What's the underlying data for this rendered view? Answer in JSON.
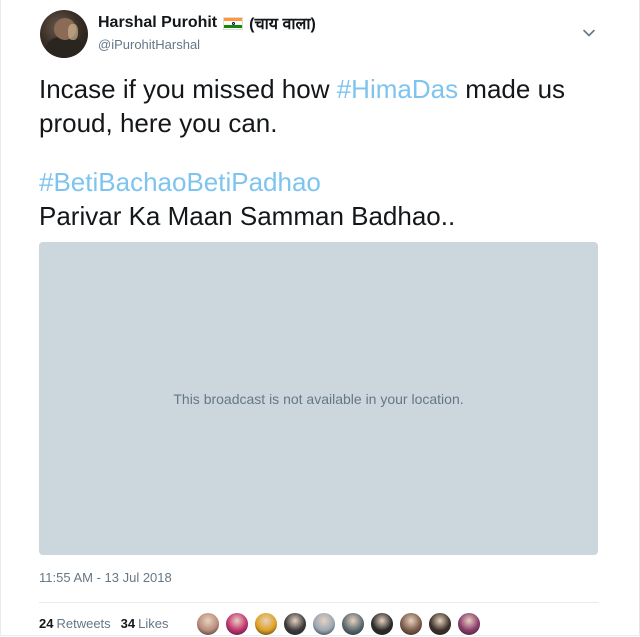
{
  "author": {
    "name": "Harshal Purohit",
    "suffix": "(चाय वाला)",
    "handle": "@iPurohitHarshal",
    "flag_icon": "india-flag-icon",
    "avatar_icon": "profile-photo"
  },
  "tweet": {
    "line1_pre": "Incase if you missed how ",
    "line1_tag": "#HimaDas",
    "line1_post": " made us",
    "line2": "proud, here you can.",
    "hashtag2": "#BetiBachaoBetiPadhao",
    "line4": "Parivar Ka Maan Samman Badhao..",
    "hashtag_color": "#7dc4ef"
  },
  "media": {
    "message": "This broadcast is not available in your location.",
    "background": "#ccd6dd"
  },
  "meta": {
    "timestamp": "11:55 AM - 13 Jul 2018"
  },
  "stats": {
    "retweets_count": "24",
    "retweets_label": "Retweets",
    "likes_count": "34",
    "likes_label": "Likes"
  },
  "likers": [
    {
      "name": "liker-avatar-1",
      "color": "#b98b7a"
    },
    {
      "name": "liker-avatar-2",
      "color": "#c03070"
    },
    {
      "name": "liker-avatar-3",
      "color": "#e0a020"
    },
    {
      "name": "liker-avatar-4",
      "color": "#3a3a3a"
    },
    {
      "name": "liker-avatar-5",
      "color": "#9aa6b4"
    },
    {
      "name": "liker-avatar-6",
      "color": "#5a6a70"
    },
    {
      "name": "liker-avatar-7",
      "color": "#2a2a2a"
    },
    {
      "name": "liker-avatar-8",
      "color": "#7a5a48"
    },
    {
      "name": "liker-avatar-9",
      "color": "#3b3028"
    },
    {
      "name": "liker-avatar-10",
      "color": "#8a3a6a"
    }
  ]
}
